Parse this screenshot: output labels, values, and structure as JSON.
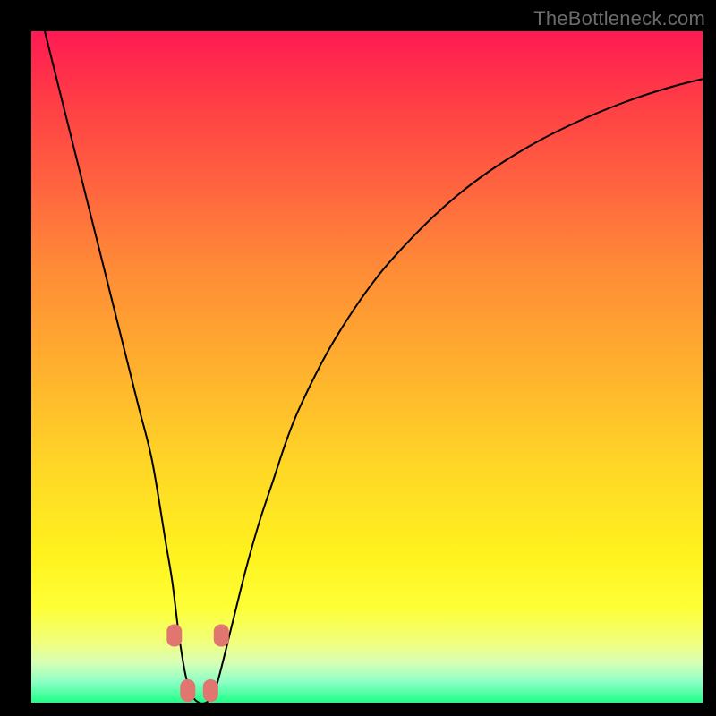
{
  "watermark": "TheBottleneck.com",
  "chart_data": {
    "type": "line",
    "title": "",
    "xlabel": "",
    "ylabel": "",
    "xlim": [
      0,
      100
    ],
    "ylim": [
      0,
      100
    ],
    "grid": false,
    "legend": false,
    "series": [
      {
        "name": "bottleneck-curve",
        "x": [
          2,
          4,
          6,
          8,
          10,
          12,
          14,
          16,
          18,
          20,
          21,
          22,
          23,
          24,
          25,
          26,
          27,
          28,
          30,
          32,
          34,
          36,
          38,
          40,
          44,
          48,
          52,
          56,
          60,
          64,
          68,
          72,
          76,
          80,
          84,
          88,
          92,
          96,
          100
        ],
        "y": [
          100,
          92,
          84,
          76,
          68,
          60,
          52,
          44,
          36,
          24,
          18,
          10,
          4,
          1,
          0,
          0,
          1,
          4,
          12,
          20,
          27,
          33,
          39,
          44,
          52,
          58.5,
          64,
          68.5,
          72.5,
          76,
          79,
          81.6,
          83.9,
          85.9,
          87.7,
          89.3,
          90.7,
          91.9,
          92.9
        ]
      }
    ],
    "markers": [
      {
        "x": 21.3,
        "y": 10,
        "label": "left-upper"
      },
      {
        "x": 23.3,
        "y": 1.8,
        "label": "left-lower"
      },
      {
        "x": 26.7,
        "y": 1.8,
        "label": "right-lower"
      },
      {
        "x": 28.3,
        "y": 10,
        "label": "right-upper"
      }
    ],
    "gradient_stops": [
      {
        "pct": 0,
        "color": "#ff1a53"
      },
      {
        "pct": 50,
        "color": "#ffb02e"
      },
      {
        "pct": 86,
        "color": "#feff37"
      },
      {
        "pct": 100,
        "color": "#1dff86"
      }
    ]
  }
}
